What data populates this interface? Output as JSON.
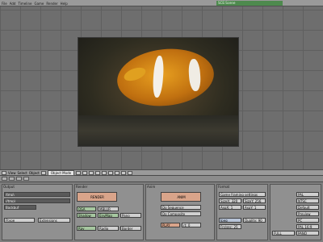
{
  "top_menu": [
    "File",
    "Add",
    "Timeline",
    "Game",
    "Render",
    "Help"
  ],
  "scene_name": "SCE:Scene",
  "top_right_label": "",
  "header_menu": [
    "View",
    "Select",
    "Object"
  ],
  "header_mode": "Object Mode",
  "render_panel": {
    "title": "Output",
    "fields": [
      "/tmp\\",
      "//tmp\\",
      "Backbuf",
      "Ftype",
      "Extensions"
    ]
  },
  "format_panel": {
    "title": "Render",
    "render_button": "RENDER",
    "fields": [
      "OSA",
      "MBLUR",
      "Shadow",
      "EnvMap",
      "Pano",
      "Ray",
      "Radio",
      "Border"
    ]
  },
  "anim_panel": {
    "title": "Anim",
    "anim_button": "ANIM",
    "fields": [
      "Do Sequence",
      "Do Composite",
      "PLAY",
      "rt: 0"
    ]
  },
  "size_panel": {
    "title": "Format",
    "fields": [
      "Game framing settings",
      "SizeX: 320",
      "SizeY: 256",
      "AspX: 1",
      "AspY: 1",
      "Jpeg",
      "Quality: 90",
      "Frs/sec: 25"
    ]
  },
  "preset_panel": {
    "fields": [
      "PAL",
      "NTSC",
      "Default",
      "Preview",
      "PC",
      "PAL 16:9",
      "PANO",
      "FULL"
    ]
  },
  "icons": [
    "view3d-icon",
    "render-icon",
    "material-icon"
  ]
}
